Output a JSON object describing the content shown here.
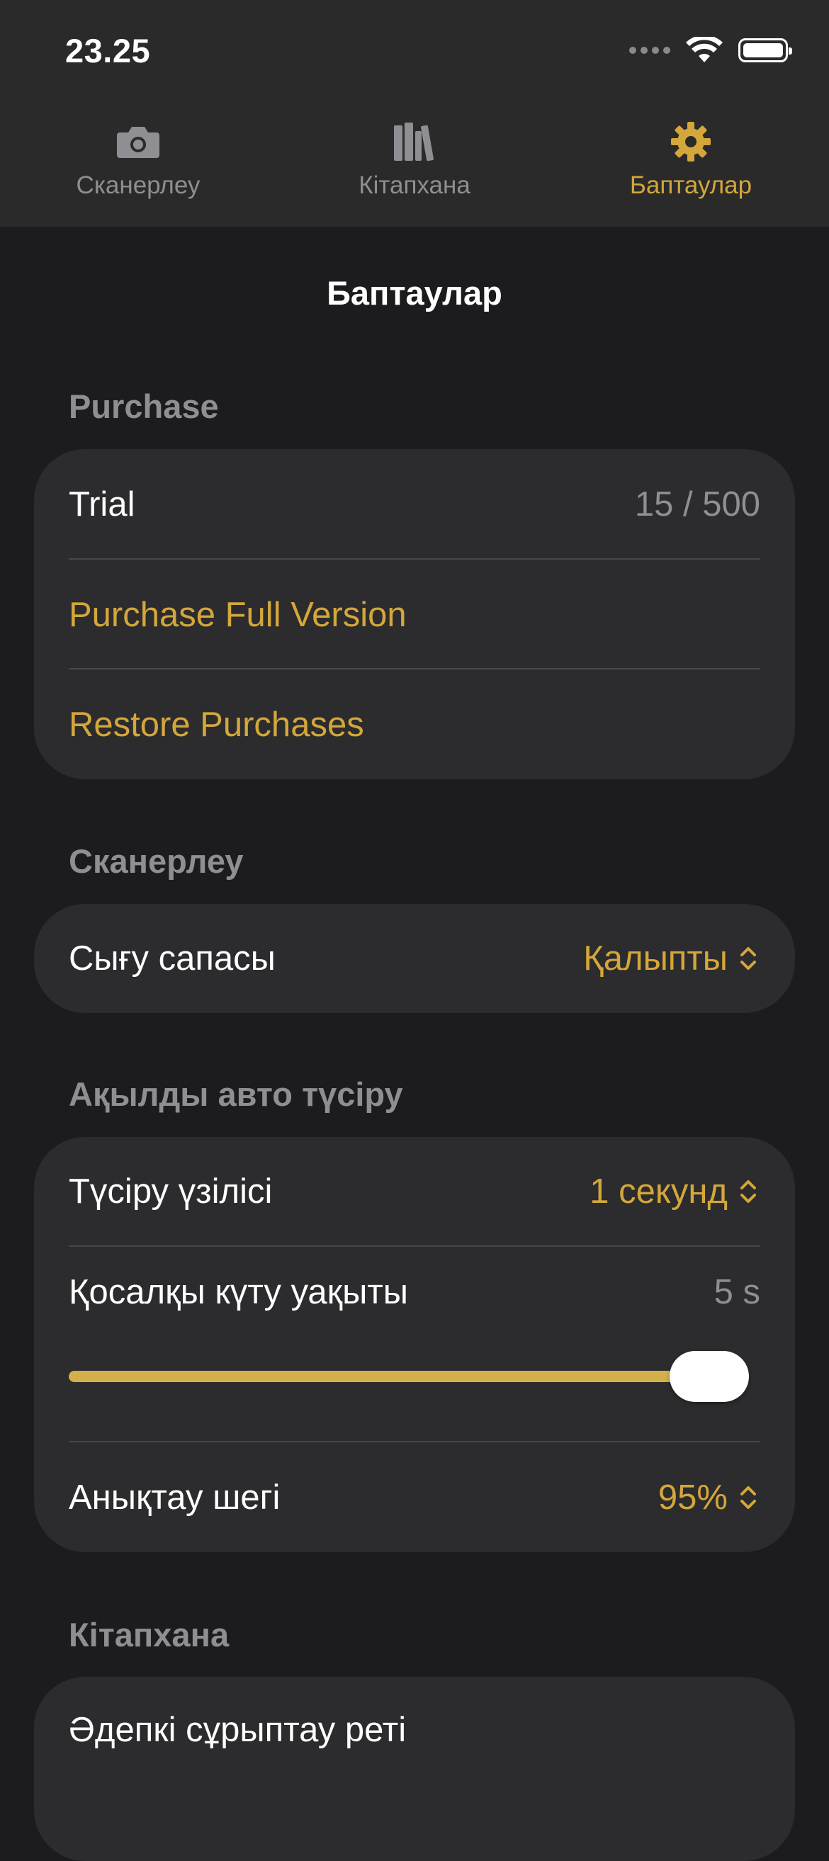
{
  "status_bar": {
    "time": "23.25"
  },
  "tabs": [
    {
      "label": "Сканерлеу",
      "icon": "camera-icon",
      "active": false
    },
    {
      "label": "Кітапхана",
      "icon": "library-icon",
      "active": false
    },
    {
      "label": "Баптаулар",
      "icon": "gear-icon",
      "active": true
    }
  ],
  "page": {
    "title": "Баптаулар"
  },
  "sections": {
    "purchase": {
      "header": "Purchase",
      "trial_label": "Trial",
      "trial_value": "15 / 500",
      "purchase_full": "Purchase Full Version",
      "restore": "Restore Purchases"
    },
    "scanning": {
      "header": "Сканерлеу",
      "output_quality_label": "Сығу сапасы",
      "output_quality_value": "Қалыпты"
    },
    "smart_capture": {
      "header": "Ақылды авто түсіру",
      "capture_interval_label": "Түсіру үзілісі",
      "capture_interval_value": "1 секунд",
      "fallback_wait_label": "Қосалқы күту уақыты",
      "fallback_wait_value": "5 s",
      "fallback_wait_slider_fraction": 1.0,
      "threshold_label": "Анықтау шегі",
      "threshold_value": "95%"
    },
    "library": {
      "header": "Кітапхана",
      "sort_order_label": "Әдепкі сұрыптау реті"
    }
  },
  "colors": {
    "accent": "#d4a73a",
    "background": "#1c1c1e",
    "card": "#2c2c2e",
    "tabbar": "#2a2a2a",
    "secondary_text": "#8e8e93"
  }
}
